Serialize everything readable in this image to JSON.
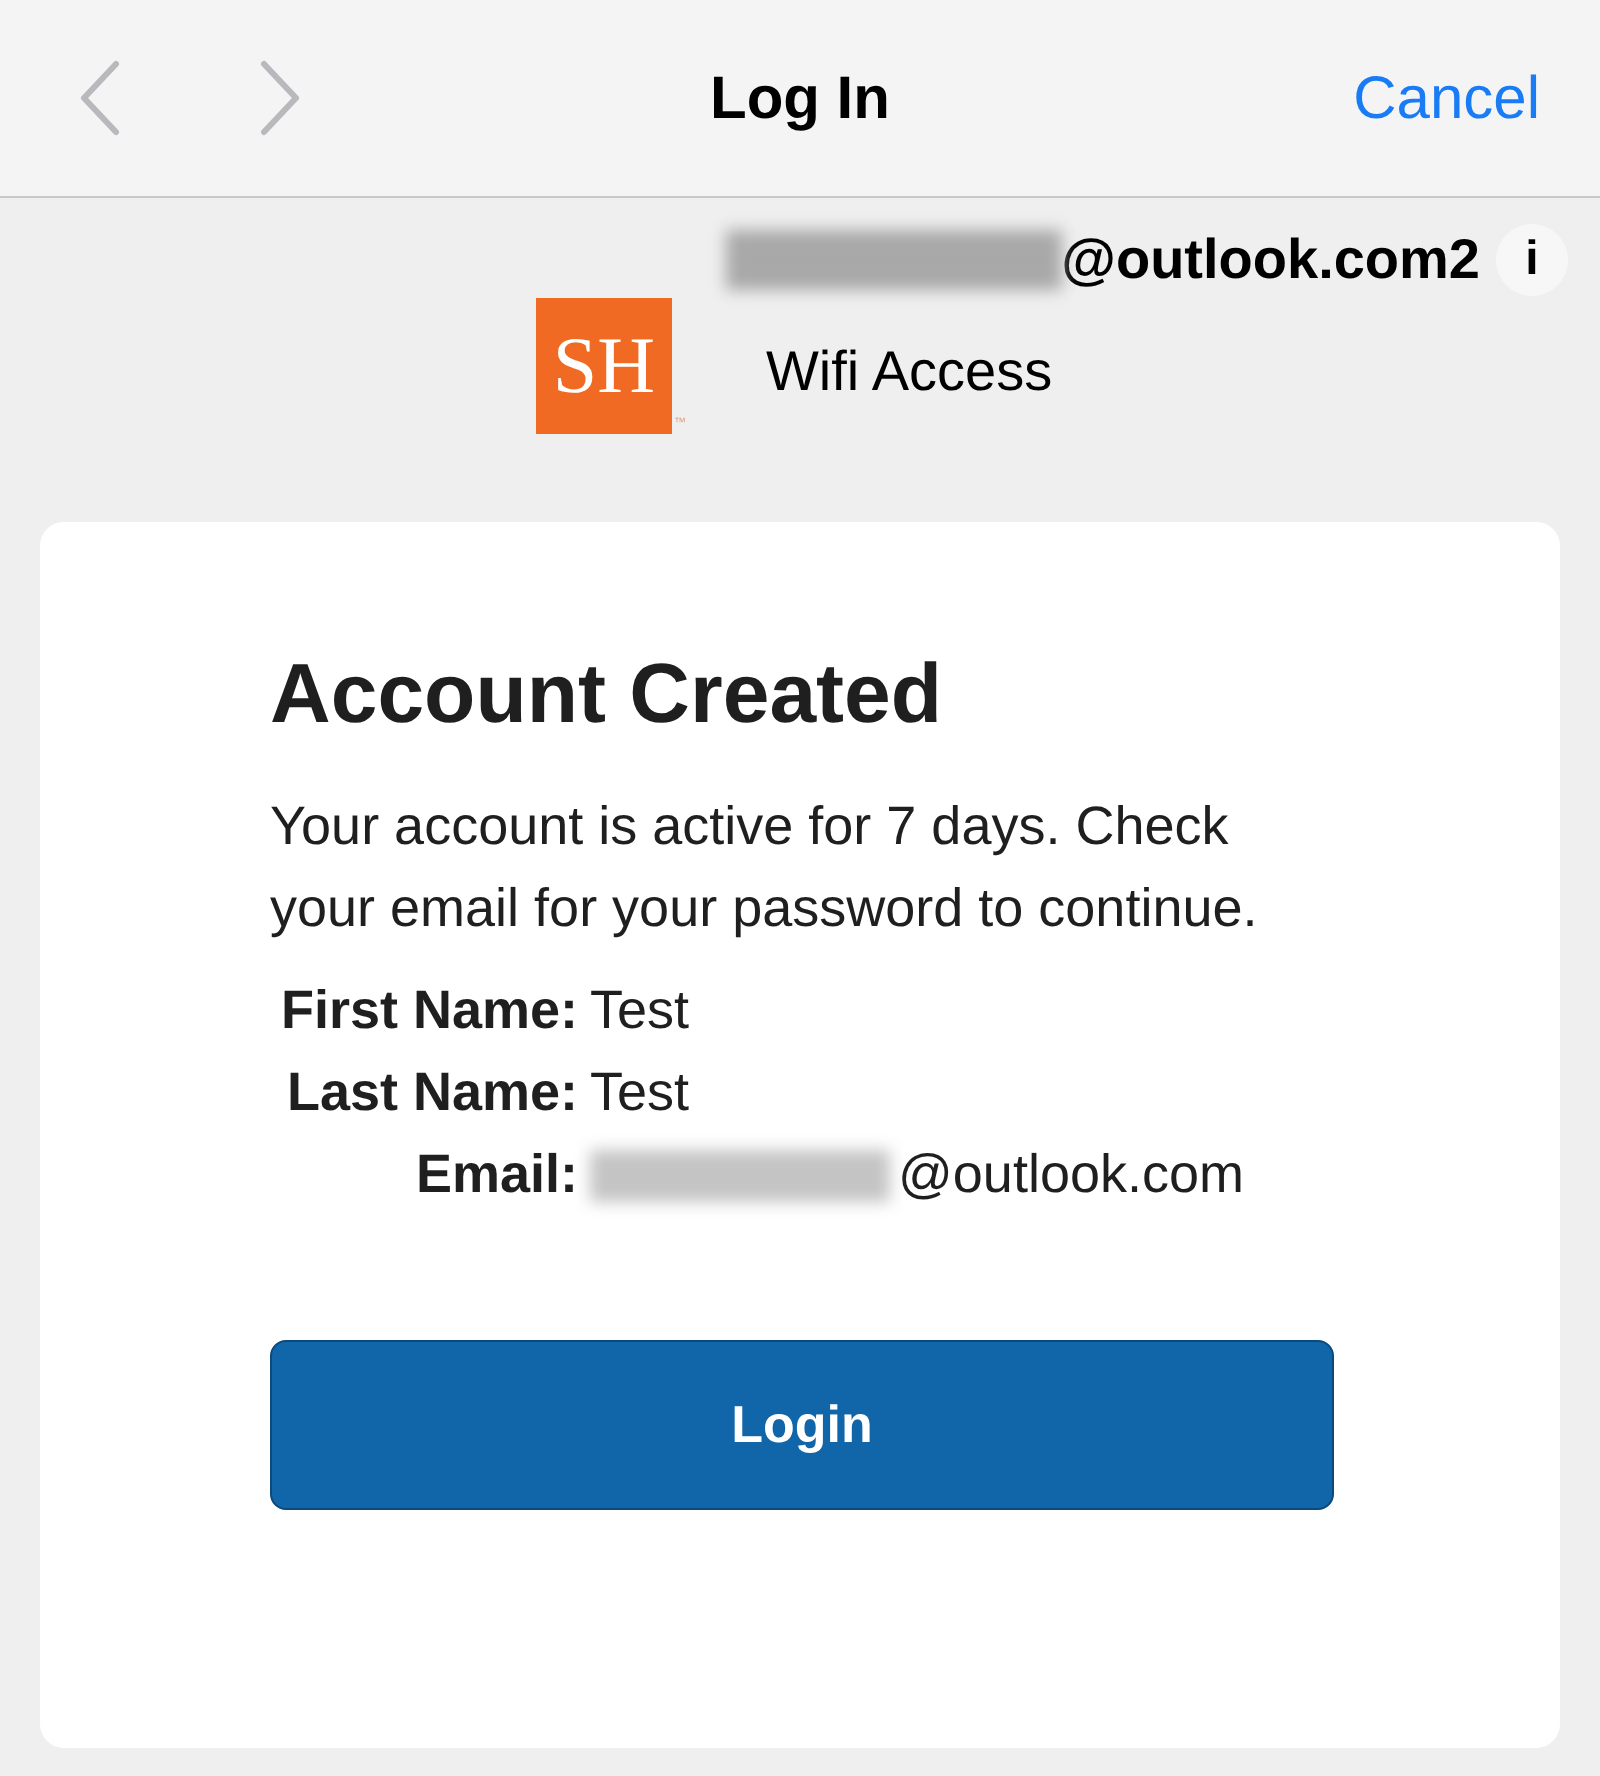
{
  "nav_bar": {
    "back": {
      "disabled": true
    },
    "forward": {
      "disabled": true
    },
    "title": "Log In",
    "cancel": "Cancel"
  },
  "account_line": {
    "email_suffix": "@outlook.com2",
    "info": "i"
  },
  "portal": {
    "logo_text": "SH",
    "logo_mark": "™",
    "name": "Wifi Access"
  },
  "card": {
    "title": "Account Created",
    "message": "Your account is active for 7 days. Check your email for your password to continue.",
    "fields": [
      {
        "label": "First Name:",
        "value": "Test",
        "redacted": false
      },
      {
        "label": "Last Name:",
        "value": "Test",
        "redacted": false
      },
      {
        "label": "Email:",
        "value": "@outlook.com",
        "redacted": true
      }
    ],
    "button": "Login"
  }
}
